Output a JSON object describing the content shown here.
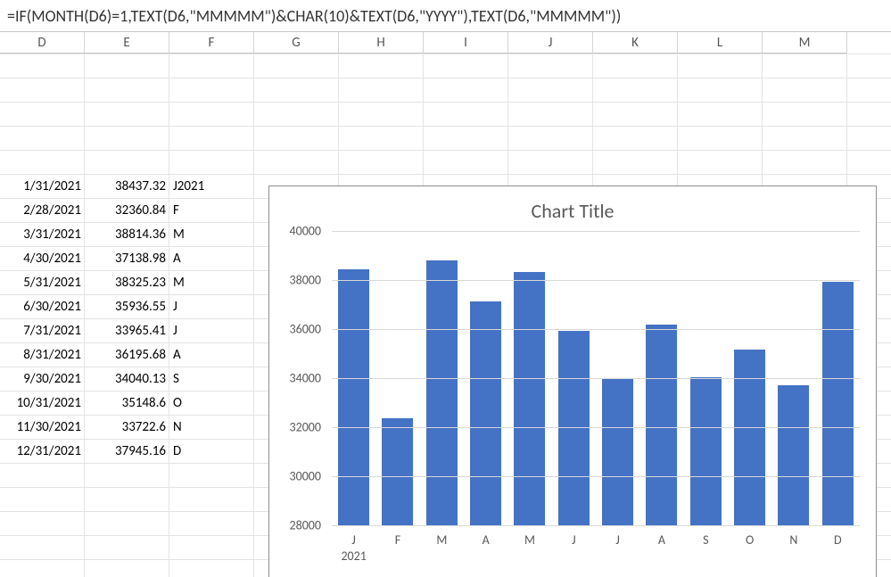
{
  "formula_bar": {
    "text": "=IF(MONTH(D6)=1,TEXT(D6,\"MMMMM\")&CHAR(10)&TEXT(D6,\"YYYY\"),TEXT(D6,\"MMMMM\"))"
  },
  "columns": [
    "D",
    "E",
    "F",
    "G",
    "H",
    "I",
    "J",
    "K",
    "L",
    "M"
  ],
  "rows": [
    {
      "date": "1/31/2021",
      "value": "38437.32",
      "label": "J2021"
    },
    {
      "date": "2/28/2021",
      "value": "32360.84",
      "label": "F"
    },
    {
      "date": "3/31/2021",
      "value": "38814.36",
      "label": "M"
    },
    {
      "date": "4/30/2021",
      "value": "37138.98",
      "label": "A"
    },
    {
      "date": "5/31/2021",
      "value": "38325.23",
      "label": "M"
    },
    {
      "date": "6/30/2021",
      "value": "35936.55",
      "label": "J"
    },
    {
      "date": "7/31/2021",
      "value": "33965.41",
      "label": "J"
    },
    {
      "date": "8/31/2021",
      "value": "36195.68",
      "label": "A"
    },
    {
      "date": "9/30/2021",
      "value": "34040.13",
      "label": "S"
    },
    {
      "date": "10/31/2021",
      "value": "35148.6",
      "label": "O"
    },
    {
      "date": "11/30/2021",
      "value": "33722.6",
      "label": "N"
    },
    {
      "date": "12/31/2021",
      "value": "37945.16",
      "label": "D"
    }
  ],
  "chart": {
    "title": "Chart Title"
  },
  "chart_data": {
    "type": "bar",
    "title": "Chart Title",
    "xlabel": "",
    "ylabel": "",
    "ylim": [
      28000,
      40000
    ],
    "yticks": [
      28000,
      30000,
      32000,
      34000,
      36000,
      38000,
      40000
    ],
    "categories": [
      "J\n2021",
      "F",
      "M",
      "A",
      "M",
      "J",
      "J",
      "A",
      "S",
      "O",
      "N",
      "D"
    ],
    "values": [
      38437.32,
      32360.84,
      38814.36,
      37138.98,
      38325.23,
      35936.55,
      33965.41,
      36195.68,
      34040.13,
      35148.6,
      33722.6,
      37945.16
    ],
    "bar_color": "#4472C4"
  }
}
